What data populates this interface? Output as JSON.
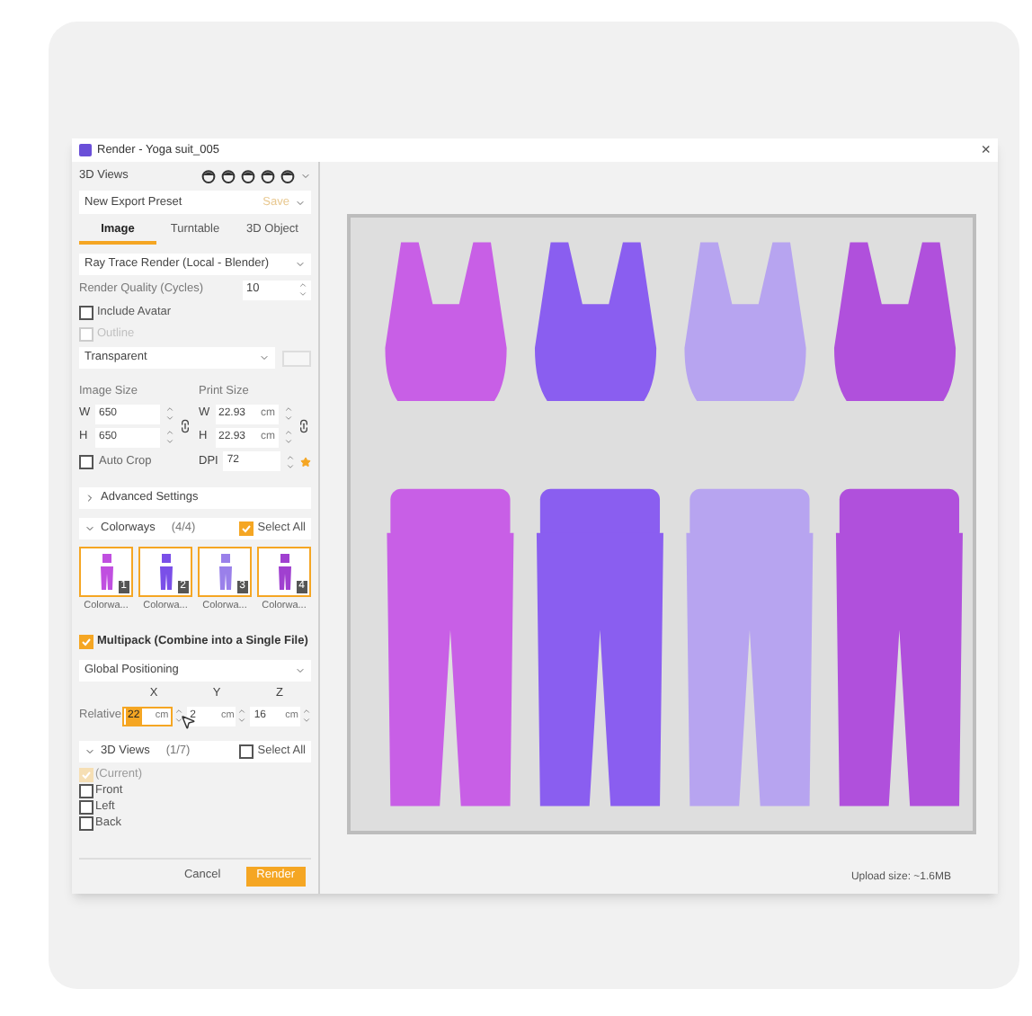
{
  "window": {
    "title": "Render - Yoga suit_005",
    "close": "×"
  },
  "views_bar": {
    "label": "3D Views"
  },
  "preset": {
    "value": "New Export Preset",
    "save": "Save"
  },
  "tabs": [
    {
      "label": "Image",
      "selected": true
    },
    {
      "label": "Turntable",
      "selected": false
    },
    {
      "label": "3D Object",
      "selected": false
    }
  ],
  "renderer": {
    "value": "Ray Trace Render (Local - Blender)"
  },
  "quality": {
    "label": "Render Quality (Cycles)",
    "value": "10"
  },
  "options": [
    {
      "label": "Include Avatar",
      "checked": false,
      "disabled": false
    },
    {
      "label": "Outline",
      "checked": false,
      "disabled": true
    }
  ],
  "background": {
    "value": "Transparent"
  },
  "image_size": {
    "label": "Image Size",
    "fields": [
      {
        "label": "W",
        "value": "650"
      },
      {
        "label": "H",
        "value": "650"
      }
    ]
  },
  "print_size": {
    "label": "Print Size",
    "fields": [
      {
        "label": "W",
        "value": "22.93",
        "unit": "cm"
      },
      {
        "label": "H",
        "value": "22.93",
        "unit": "cm"
      }
    ]
  },
  "auto_crop": {
    "label": "Auto Crop",
    "checked": false
  },
  "dpi": {
    "label": "DPI",
    "value": "72"
  },
  "advanced": {
    "label": "Advanced Settings",
    "expanded": false
  },
  "colorways": {
    "label": "Colorways",
    "count": "(4/4)",
    "expanded": true,
    "select_all": {
      "label": "Select All",
      "checked": true
    },
    "items": [
      {
        "label": "Colorwa...",
        "number": "1",
        "color": "#c04fe0",
        "selected": true
      },
      {
        "label": "Colorwa...",
        "number": "2",
        "color": "#7a4fe8",
        "selected": true
      },
      {
        "label": "Colorwa...",
        "number": "3",
        "color": "#9a80ea",
        "selected": true
      },
      {
        "label": "Colorwa...",
        "number": "4",
        "color": "#a040d0",
        "selected": true
      }
    ]
  },
  "multipack": {
    "label": "Multipack (Combine into a Single File)",
    "checked": true
  },
  "positioning": {
    "value": "Global Positioning"
  },
  "axes": [
    "X",
    "Y",
    "Z"
  ],
  "relative": {
    "label": "Relative",
    "fields": [
      {
        "value": "22",
        "unit": "cm",
        "focused": true
      },
      {
        "value": "2",
        "unit": "cm",
        "focused": false
      },
      {
        "value": "16",
        "unit": "cm",
        "focused": false
      }
    ]
  },
  "views": {
    "label": "3D Views",
    "count": "(1/7)",
    "expanded": true,
    "select_all": {
      "label": "Select All",
      "checked": false
    },
    "items": [
      {
        "label": "(Current)",
        "checked": true,
        "disabled": true
      },
      {
        "label": "Front",
        "checked": false,
        "disabled": false
      },
      {
        "label": "Left",
        "checked": false,
        "disabled": false
      },
      {
        "label": "Back",
        "checked": false,
        "disabled": false
      }
    ]
  },
  "buttons": [
    {
      "label": "Cancel",
      "kind": "secondary"
    },
    {
      "label": "Render",
      "kind": "primary"
    }
  ],
  "status": {
    "upload_size": "Upload size: ~1.6MB"
  }
}
